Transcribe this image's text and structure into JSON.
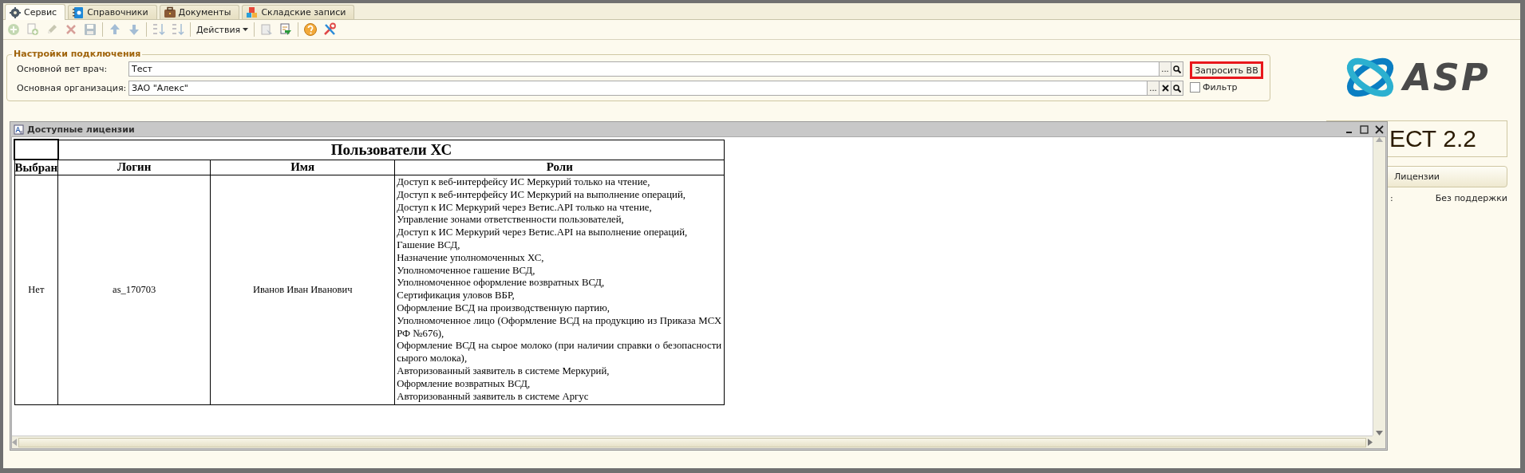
{
  "tabs": [
    {
      "label": "Сервис",
      "selected": true
    },
    {
      "label": "Справочники",
      "selected": false
    },
    {
      "label": "Документы",
      "selected": false
    },
    {
      "label": "Складские записи",
      "selected": false
    }
  ],
  "toolbar": [
    {
      "kind": "icon",
      "disabled": true
    },
    {
      "kind": "icon",
      "disabled": true
    },
    {
      "kind": "icon",
      "disabled": true
    },
    {
      "kind": "icon",
      "disabled": true
    },
    {
      "kind": "icon",
      "disabled": true
    },
    {
      "kind": "separator"
    },
    {
      "kind": "icon",
      "disabled": true
    },
    {
      "kind": "icon",
      "disabled": true
    },
    {
      "kind": "separator"
    },
    {
      "kind": "icon",
      "disabled": true
    },
    {
      "kind": "icon",
      "disabled": true
    },
    {
      "kind": "separator"
    },
    {
      "kind": "menu",
      "label": "Действия",
      "disabled": false
    },
    {
      "kind": "separator"
    },
    {
      "kind": "icon",
      "disabled": true
    },
    {
      "kind": "icon",
      "disabled": false
    },
    {
      "kind": "separator"
    },
    {
      "kind": "icon",
      "disabled": false
    },
    {
      "kind": "icon",
      "disabled": false
    }
  ],
  "settings": {
    "title": "Настройки подключения",
    "fields": [
      {
        "label": "Основной вет врач:",
        "value": "Тест",
        "buttons": [
          {
            "kind": "choose",
            "label": "..."
          },
          {
            "kind": "search"
          }
        ]
      },
      {
        "label": "Основная организация:",
        "value": "ЗАО \"Алекс\"",
        "buttons": [
          {
            "kind": "choose",
            "label": "..."
          },
          {
            "kind": "clear"
          },
          {
            "kind": "search"
          }
        ]
      }
    ],
    "request_button": {
      "label": "Запросить ВВ",
      "highlighted": true
    },
    "filter": {
      "label": "Фильтр",
      "checked": false
    }
  },
  "right_panel": {
    "logo_text": "ASP",
    "product": "ЕСТ 2.2",
    "licenses_button": "Лицензии",
    "label": ":",
    "support": "Без поддержки"
  },
  "window": {
    "title": "Доступные лицензии",
    "report": {
      "title": "Пользователи ХС",
      "columns": [
        "Выбран",
        "Логин",
        "Имя",
        "Роли"
      ],
      "rows": [
        {
          "selected_text": "Нет",
          "login": "as_170703",
          "name": "Иванов Иван Иванович",
          "roles": [
            "Доступ к веб-интерфейсу ИС Меркурий только на чтение,",
            "Доступ к веб-интерфейсу ИС Меркурий на выполнение операций,",
            "Доступ к ИС Меркурий через Ветис.API только на чтение,",
            "Управление зонами ответственности пользователей,",
            "Доступ к ИС Меркурий через Ветис.API на выполнение операций,",
            "Гашение ВСД,",
            "Назначение уполномоченных ХС,",
            "Уполномоченное гашение ВСД,",
            "Уполномоченное оформление возвратных ВСД,",
            "Сертификация уловов ВБР,",
            "Оформление ВСД на производственную партию,",
            "Уполномоченное лицо (Оформление ВСД на продукцию из Приказа МСХ РФ №676),",
            "Оформление ВСД на сырое молоко (при наличии справки о безопасности сырого молока),",
            "Авторизованный заявитель в системе Меркурий,",
            "Оформление возвратных ВСД,",
            "Авторизованный заявитель в системе Аргус"
          ]
        }
      ]
    }
  }
}
